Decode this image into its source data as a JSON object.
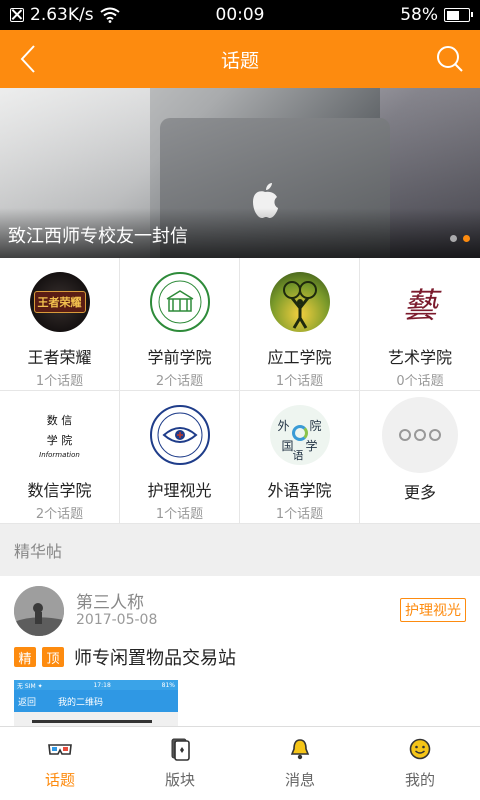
{
  "status_bar": {
    "speed": "2.63K/s",
    "time": "00:09",
    "battery": "58%",
    "battery_level": 0.58
  },
  "header": {
    "title": "话题"
  },
  "banner": {
    "caption": "致江西师专校友一封信",
    "slide_count": 2,
    "active_slide": 2
  },
  "categories": [
    {
      "name": "王者荣耀",
      "count": "1个话题",
      "icon": "wangzhe-logo-icon"
    },
    {
      "name": "学前学院",
      "count": "2个话题",
      "icon": "xueqian-logo-icon"
    },
    {
      "name": "应工学院",
      "count": "1个话题",
      "icon": "yinggong-logo-icon"
    },
    {
      "name": "艺术学院",
      "count": "0个话题",
      "icon": "yishu-logo-icon"
    },
    {
      "name": "数信学院",
      "count": "2个话题",
      "icon": "shuxin-logo-icon"
    },
    {
      "name": "护理视光",
      "count": "1个话题",
      "icon": "huli-logo-icon"
    },
    {
      "name": "外语学院",
      "count": "1个话题",
      "icon": "waiyu-logo-icon"
    },
    {
      "name": "更多",
      "count": "",
      "icon": "more-dots-icon"
    }
  ],
  "logo_text": {
    "wangzhe": "王者荣耀",
    "yishu": "藝",
    "shuxin_line1": "数 信",
    "shuxin_line2": "学 院",
    "shuxin_line3": "Information",
    "waiyu_1": "外",
    "waiyu_2": "院",
    "waiyu_3": "国",
    "waiyu_4": "学",
    "waiyu_5": "语"
  },
  "featured": {
    "section_title": "精华帖",
    "post": {
      "author": "第三人称",
      "date": "2017-05-08",
      "tag": "护理视光",
      "badges": [
        "精",
        "顶"
      ],
      "title": "师专闲置物品交易站",
      "thumb": {
        "status_left": "无 SIM ✦",
        "status_time": "17:18",
        "status_right": "81%",
        "back_label": "返回",
        "page_title": "我的二维码"
      }
    }
  },
  "tabs": [
    {
      "label": "话题",
      "icon": "glasses-icon",
      "active": true
    },
    {
      "label": "版块",
      "icon": "cards-icon",
      "active": false
    },
    {
      "label": "消息",
      "icon": "bell-icon",
      "active": false
    },
    {
      "label": "我的",
      "icon": "smiley-icon",
      "active": false
    }
  ],
  "colors": {
    "accent": "#fd8b0f",
    "background": "#efefef"
  }
}
